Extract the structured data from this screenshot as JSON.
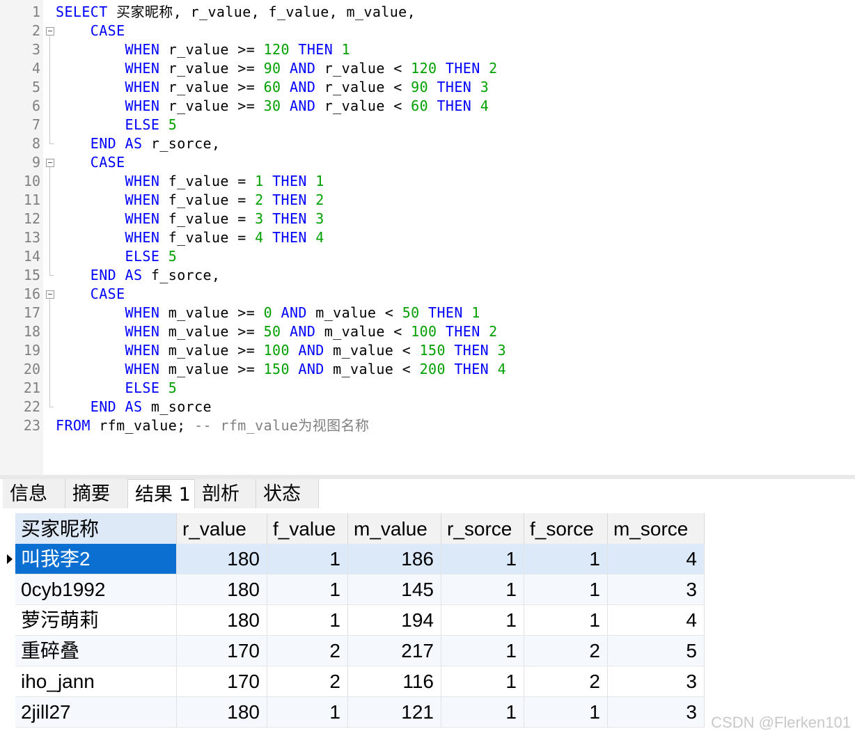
{
  "editor": {
    "lines": [
      [
        [
          "kw",
          "SELECT"
        ],
        [
          "t",
          " 买家昵称, r_value, f_value, m_value,"
        ]
      ],
      [
        [
          "t",
          "    "
        ],
        [
          "kw",
          "CASE"
        ]
      ],
      [
        [
          "t",
          "        "
        ],
        [
          "kw",
          "WHEN"
        ],
        [
          "t",
          " r_value >= "
        ],
        [
          "num",
          "120"
        ],
        [
          "t",
          " "
        ],
        [
          "kw",
          "THEN"
        ],
        [
          "t",
          " "
        ],
        [
          "num",
          "1"
        ]
      ],
      [
        [
          "t",
          "        "
        ],
        [
          "kw",
          "WHEN"
        ],
        [
          "t",
          " r_value >= "
        ],
        [
          "num",
          "90"
        ],
        [
          "t",
          " "
        ],
        [
          "kw",
          "AND"
        ],
        [
          "t",
          " r_value < "
        ],
        [
          "num",
          "120"
        ],
        [
          "t",
          " "
        ],
        [
          "kw",
          "THEN"
        ],
        [
          "t",
          " "
        ],
        [
          "num",
          "2"
        ]
      ],
      [
        [
          "t",
          "        "
        ],
        [
          "kw",
          "WHEN"
        ],
        [
          "t",
          " r_value >= "
        ],
        [
          "num",
          "60"
        ],
        [
          "t",
          " "
        ],
        [
          "kw",
          "AND"
        ],
        [
          "t",
          " r_value < "
        ],
        [
          "num",
          "90"
        ],
        [
          "t",
          " "
        ],
        [
          "kw",
          "THEN"
        ],
        [
          "t",
          " "
        ],
        [
          "num",
          "3"
        ]
      ],
      [
        [
          "t",
          "        "
        ],
        [
          "kw",
          "WHEN"
        ],
        [
          "t",
          " r_value >= "
        ],
        [
          "num",
          "30"
        ],
        [
          "t",
          " "
        ],
        [
          "kw",
          "AND"
        ],
        [
          "t",
          " r_value < "
        ],
        [
          "num",
          "60"
        ],
        [
          "t",
          " "
        ],
        [
          "kw",
          "THEN"
        ],
        [
          "t",
          " "
        ],
        [
          "num",
          "4"
        ]
      ],
      [
        [
          "t",
          "        "
        ],
        [
          "kw",
          "ELSE"
        ],
        [
          "t",
          " "
        ],
        [
          "num",
          "5"
        ]
      ],
      [
        [
          "t",
          "    "
        ],
        [
          "kw",
          "END"
        ],
        [
          "t",
          " "
        ],
        [
          "kw",
          "AS"
        ],
        [
          "t",
          " r_sorce,"
        ]
      ],
      [
        [
          "t",
          "    "
        ],
        [
          "kw",
          "CASE"
        ]
      ],
      [
        [
          "t",
          "        "
        ],
        [
          "kw",
          "WHEN"
        ],
        [
          "t",
          " f_value = "
        ],
        [
          "num",
          "1"
        ],
        [
          "t",
          " "
        ],
        [
          "kw",
          "THEN"
        ],
        [
          "t",
          " "
        ],
        [
          "num",
          "1"
        ]
      ],
      [
        [
          "t",
          "        "
        ],
        [
          "kw",
          "WHEN"
        ],
        [
          "t",
          " f_value = "
        ],
        [
          "num",
          "2"
        ],
        [
          "t",
          " "
        ],
        [
          "kw",
          "THEN"
        ],
        [
          "t",
          " "
        ],
        [
          "num",
          "2"
        ]
      ],
      [
        [
          "t",
          "        "
        ],
        [
          "kw",
          "WHEN"
        ],
        [
          "t",
          " f_value = "
        ],
        [
          "num",
          "3"
        ],
        [
          "t",
          " "
        ],
        [
          "kw",
          "THEN"
        ],
        [
          "t",
          " "
        ],
        [
          "num",
          "3"
        ]
      ],
      [
        [
          "t",
          "        "
        ],
        [
          "kw",
          "WHEN"
        ],
        [
          "t",
          " f_value = "
        ],
        [
          "num",
          "4"
        ],
        [
          "t",
          " "
        ],
        [
          "kw",
          "THEN"
        ],
        [
          "t",
          " "
        ],
        [
          "num",
          "4"
        ]
      ],
      [
        [
          "t",
          "        "
        ],
        [
          "kw",
          "ELSE"
        ],
        [
          "t",
          " "
        ],
        [
          "num",
          "5"
        ]
      ],
      [
        [
          "t",
          "    "
        ],
        [
          "kw",
          "END"
        ],
        [
          "t",
          " "
        ],
        [
          "kw",
          "AS"
        ],
        [
          "t",
          " f_sorce,"
        ]
      ],
      [
        [
          "t",
          "    "
        ],
        [
          "kw",
          "CASE"
        ]
      ],
      [
        [
          "t",
          "        "
        ],
        [
          "kw",
          "WHEN"
        ],
        [
          "t",
          " m_value >= "
        ],
        [
          "num",
          "0"
        ],
        [
          "t",
          " "
        ],
        [
          "kw",
          "AND"
        ],
        [
          "t",
          " m_value < "
        ],
        [
          "num",
          "50"
        ],
        [
          "t",
          " "
        ],
        [
          "kw",
          "THEN"
        ],
        [
          "t",
          " "
        ],
        [
          "num",
          "1"
        ]
      ],
      [
        [
          "t",
          "        "
        ],
        [
          "kw",
          "WHEN"
        ],
        [
          "t",
          " m_value >= "
        ],
        [
          "num",
          "50"
        ],
        [
          "t",
          " "
        ],
        [
          "kw",
          "AND"
        ],
        [
          "t",
          " m_value < "
        ],
        [
          "num",
          "100"
        ],
        [
          "t",
          " "
        ],
        [
          "kw",
          "THEN"
        ],
        [
          "t",
          " "
        ],
        [
          "num",
          "2"
        ]
      ],
      [
        [
          "t",
          "        "
        ],
        [
          "kw",
          "WHEN"
        ],
        [
          "t",
          " m_value >= "
        ],
        [
          "num",
          "100"
        ],
        [
          "t",
          " "
        ],
        [
          "kw",
          "AND"
        ],
        [
          "t",
          " m_value < "
        ],
        [
          "num",
          "150"
        ],
        [
          "t",
          " "
        ],
        [
          "kw",
          "THEN"
        ],
        [
          "t",
          " "
        ],
        [
          "num",
          "3"
        ]
      ],
      [
        [
          "t",
          "        "
        ],
        [
          "kw",
          "WHEN"
        ],
        [
          "t",
          " m_value >= "
        ],
        [
          "num",
          "150"
        ],
        [
          "t",
          " "
        ],
        [
          "kw",
          "AND"
        ],
        [
          "t",
          " m_value < "
        ],
        [
          "num",
          "200"
        ],
        [
          "t",
          " "
        ],
        [
          "kw",
          "THEN"
        ],
        [
          "t",
          " "
        ],
        [
          "num",
          "4"
        ]
      ],
      [
        [
          "t",
          "        "
        ],
        [
          "kw",
          "ELSE"
        ],
        [
          "t",
          " "
        ],
        [
          "num",
          "5"
        ]
      ],
      [
        [
          "t",
          "    "
        ],
        [
          "kw",
          "END"
        ],
        [
          "t",
          " "
        ],
        [
          "kw",
          "AS"
        ],
        [
          "t",
          " m_sorce"
        ]
      ],
      [
        [
          "kw",
          "FROM"
        ],
        [
          "t",
          " rfm_value; "
        ],
        [
          "cmt",
          "-- rfm_value为视图名称"
        ]
      ]
    ],
    "line_numbers": [
      "1",
      "2",
      "3",
      "4",
      "5",
      "6",
      "7",
      "8",
      "9",
      "10",
      "11",
      "12",
      "13",
      "14",
      "15",
      "16",
      "17",
      "18",
      "19",
      "20",
      "21",
      "22",
      "23"
    ]
  },
  "tabs": [
    {
      "label": "信息",
      "active": false
    },
    {
      "label": "摘要",
      "active": false
    },
    {
      "label": "结果 1",
      "active": true
    },
    {
      "label": "剖析",
      "active": false
    },
    {
      "label": "状态",
      "active": false
    }
  ],
  "results": {
    "columns": [
      "买家昵称",
      "r_value",
      "f_value",
      "m_value",
      "r_sorce",
      "f_sorce",
      "m_sorce"
    ],
    "rows": [
      [
        "叫我李2",
        "180",
        "1",
        "186",
        "1",
        "1",
        "4"
      ],
      [
        "0cyb1992",
        "180",
        "1",
        "145",
        "1",
        "1",
        "3"
      ],
      [
        "萝污萌莉",
        "180",
        "1",
        "194",
        "1",
        "1",
        "4"
      ],
      [
        "重碎叠",
        "170",
        "2",
        "217",
        "1",
        "2",
        "5"
      ],
      [
        "iho_jann",
        "170",
        "2",
        "116",
        "1",
        "2",
        "3"
      ],
      [
        "2jill27",
        "180",
        "1",
        "121",
        "1",
        "1",
        "3"
      ]
    ],
    "selected_row": 0
  },
  "watermark": "CSDN @Flerken101"
}
